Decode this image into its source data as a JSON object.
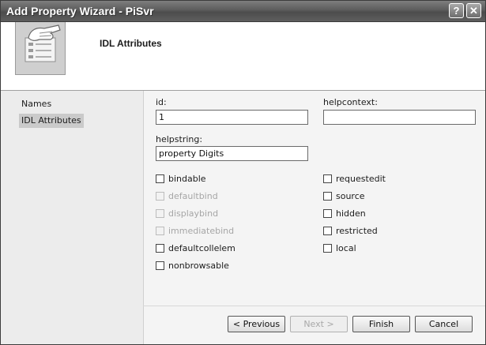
{
  "window": {
    "title": "Add Property Wizard - PiSvr",
    "help_glyph": "?",
    "close_glyph": "✕"
  },
  "header": {
    "title": "IDL Attributes",
    "icon": "document-hand-icon"
  },
  "nav": {
    "items": [
      {
        "label": "Names",
        "selected": false
      },
      {
        "label": "IDL Attributes",
        "selected": true
      }
    ]
  },
  "form": {
    "id": {
      "label": "id:",
      "value": "1"
    },
    "helpcontext": {
      "label": "helpcontext:",
      "value": ""
    },
    "helpstring": {
      "label": "helpstring:",
      "value": "property Digits"
    },
    "left_checks": [
      {
        "label": "bindable",
        "checked": false,
        "enabled": true
      },
      {
        "label": "defaultbind",
        "checked": false,
        "enabled": false
      },
      {
        "label": "displaybind",
        "checked": false,
        "enabled": false
      },
      {
        "label": "immediatebind",
        "checked": false,
        "enabled": false
      },
      {
        "label": "defaultcollelem",
        "checked": false,
        "enabled": true
      },
      {
        "label": "nonbrowsable",
        "checked": false,
        "enabled": true
      }
    ],
    "right_checks": [
      {
        "label": "requestedit",
        "checked": false,
        "enabled": true
      },
      {
        "label": "source",
        "checked": false,
        "enabled": true
      },
      {
        "label": "hidden",
        "checked": false,
        "enabled": true
      },
      {
        "label": "restricted",
        "checked": false,
        "enabled": true
      },
      {
        "label": "local",
        "checked": false,
        "enabled": true
      }
    ]
  },
  "buttons": {
    "previous": "< Previous",
    "next": "Next >",
    "finish": "Finish",
    "cancel": "Cancel"
  }
}
